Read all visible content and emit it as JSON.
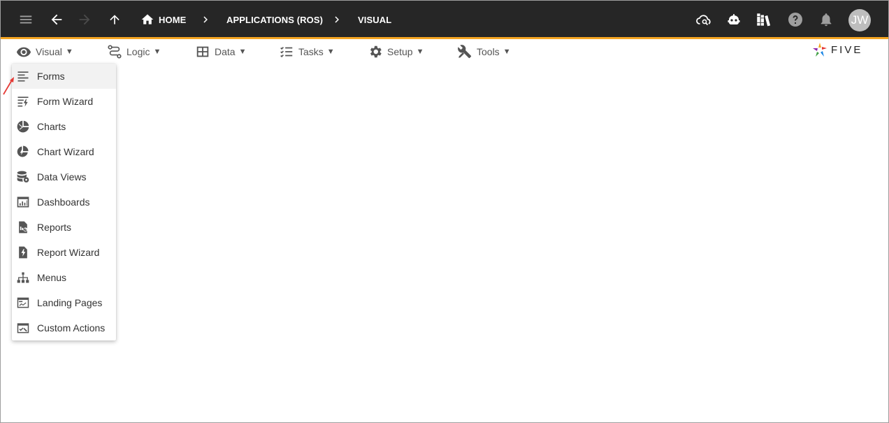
{
  "breadcrumbs": {
    "home": "HOME",
    "applications": "APPLICATIONS (ROS)",
    "visual": "VISUAL"
  },
  "user": {
    "initials": "JW"
  },
  "menubar": {
    "items": [
      {
        "label": "Visual",
        "icon": "eye-icon"
      },
      {
        "label": "Logic",
        "icon": "logic-icon"
      },
      {
        "label": "Data",
        "icon": "table-icon"
      },
      {
        "label": "Tasks",
        "icon": "checklist-icon"
      },
      {
        "label": "Setup",
        "icon": "gear-icon"
      },
      {
        "label": "Tools",
        "icon": "tools-icon"
      }
    ],
    "caret": "▼"
  },
  "logo": {
    "text": "FIVE"
  },
  "dropdown": {
    "items": [
      {
        "label": "Forms",
        "icon": "forms-icon"
      },
      {
        "label": "Form Wizard",
        "icon": "form-wizard-icon"
      },
      {
        "label": "Charts",
        "icon": "pie-chart-icon"
      },
      {
        "label": "Chart Wizard",
        "icon": "chart-wizard-icon"
      },
      {
        "label": "Data Views",
        "icon": "database-eye-icon"
      },
      {
        "label": "Dashboards",
        "icon": "dashboard-icon"
      },
      {
        "label": "Reports",
        "icon": "report-icon"
      },
      {
        "label": "Report Wizard",
        "icon": "report-wizard-icon"
      },
      {
        "label": "Menus",
        "icon": "sitemap-icon"
      },
      {
        "label": "Landing Pages",
        "icon": "landing-page-icon"
      },
      {
        "label": "Custom Actions",
        "icon": "custom-actions-icon"
      }
    ]
  },
  "colors": {
    "appbar": "#262626",
    "accent": "#f5a623",
    "icon": "#555555"
  }
}
